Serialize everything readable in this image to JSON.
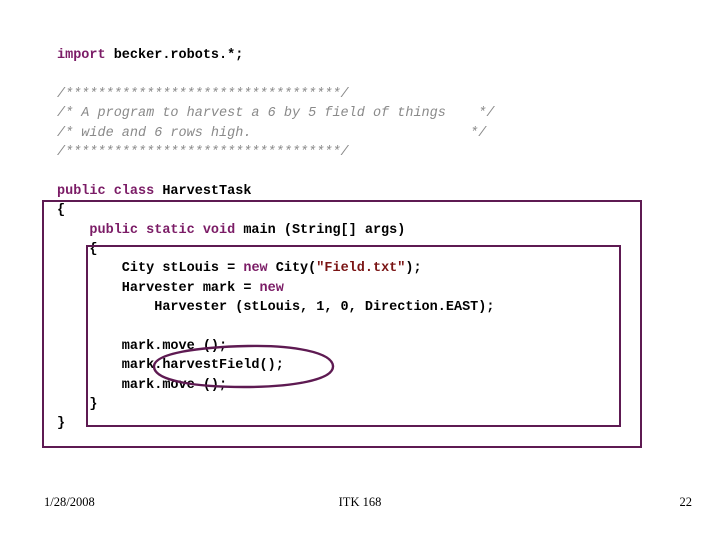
{
  "slide": {
    "code_lines": [
      {
        "id": "import",
        "segments": [
          {
            "cls": "kw",
            "text": "import"
          },
          {
            "cls": "plain",
            "text": " becker.robots.*;"
          }
        ]
      },
      {
        "id": "blank1",
        "segments": [
          {
            "cls": "plain",
            "text": ""
          }
        ]
      },
      {
        "id": "comment-top-border",
        "segments": [
          {
            "cls": "cmt",
            "text": "/**********************************/"
          }
        ]
      },
      {
        "id": "comment-line-1",
        "segments": [
          {
            "cls": "cmt",
            "text": "/* A program to harvest a 6 by 5 field of things    */"
          }
        ]
      },
      {
        "id": "comment-line-2",
        "segments": [
          {
            "cls": "cmt",
            "text": "/* wide and 6 rows high.                           */"
          }
        ]
      },
      {
        "id": "comment-bottom-border",
        "segments": [
          {
            "cls": "cmt",
            "text": "/**********************************/"
          }
        ]
      },
      {
        "id": "blank2",
        "segments": [
          {
            "cls": "plain",
            "text": ""
          }
        ]
      },
      {
        "id": "class-decl",
        "segments": [
          {
            "cls": "kw",
            "text": "public class"
          },
          {
            "cls": "plain",
            "text": " HarvestTask"
          }
        ]
      },
      {
        "id": "class-open-brace",
        "segments": [
          {
            "cls": "plain",
            "text": "{"
          }
        ]
      },
      {
        "id": "main-signature",
        "segments": [
          {
            "cls": "plain",
            "text": "    "
          },
          {
            "cls": "kw",
            "text": "public static void"
          },
          {
            "cls": "plain",
            "text": " main (String[] args)"
          }
        ]
      },
      {
        "id": "main-open-brace",
        "segments": [
          {
            "cls": "plain",
            "text": "    {"
          }
        ]
      },
      {
        "id": "decl-city",
        "segments": [
          {
            "cls": "plain",
            "text": "        City stLouis = "
          },
          {
            "cls": "kw",
            "text": "new"
          },
          {
            "cls": "plain",
            "text": " City("
          },
          {
            "cls": "str",
            "text": "\"Field.txt\""
          },
          {
            "cls": "plain",
            "text": ");"
          }
        ]
      },
      {
        "id": "decl-harvester",
        "segments": [
          {
            "cls": "plain",
            "text": "        Harvester mark = "
          },
          {
            "cls": "kw",
            "text": "new"
          }
        ]
      },
      {
        "id": "decl-harvester-args",
        "segments": [
          {
            "cls": "plain",
            "text": "            Harvester (stLouis, 1, 0, Direction.EAST);"
          }
        ]
      },
      {
        "id": "blank3",
        "segments": [
          {
            "cls": "plain",
            "text": ""
          }
        ]
      },
      {
        "id": "stmt-move-1",
        "segments": [
          {
            "cls": "plain",
            "text": "        mark.move ();"
          }
        ]
      },
      {
        "id": "stmt-harvest-field",
        "segments": [
          {
            "cls": "plain",
            "text": "        mark.harvestField();"
          }
        ]
      },
      {
        "id": "stmt-move-2",
        "segments": [
          {
            "cls": "plain",
            "text": "        mark.move ();"
          }
        ]
      },
      {
        "id": "main-close-brace",
        "segments": [
          {
            "cls": "plain",
            "text": "    }"
          }
        ]
      },
      {
        "id": "class-close-brace",
        "segments": [
          {
            "cls": "plain",
            "text": "}"
          }
        ]
      }
    ],
    "annotations": {
      "color": "#5e1a52",
      "outer_rect_label": "class-body-highlight",
      "inner_rect_label": "main-body-highlight",
      "ellipse_label": "harvest-field-call-circle"
    }
  },
  "footer": {
    "date": "1/28/2008",
    "course": "ITK 168",
    "page_number": "22"
  }
}
